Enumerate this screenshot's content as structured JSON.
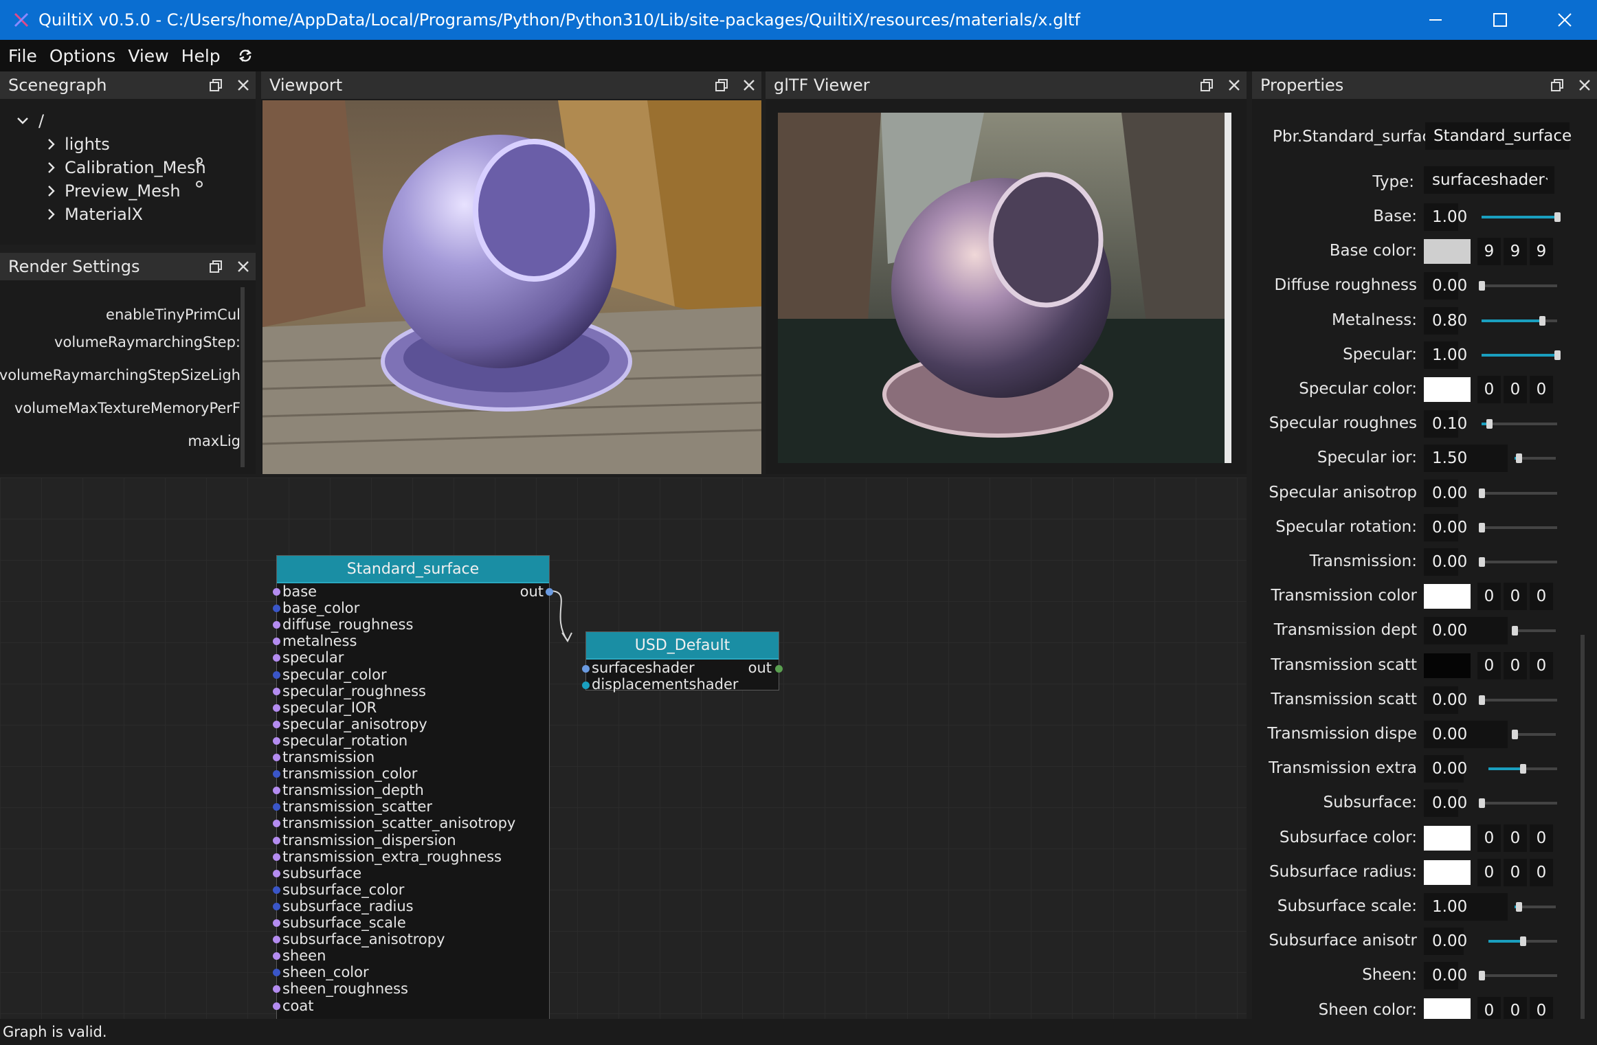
{
  "window": {
    "title": "QuiltiX v0.5.0 - C:/Users/home/AppData/Local/Programs/Python/Python310/Lib/site-packages/QuiltiX/resources/materials/x.gltf"
  },
  "menu": [
    "File",
    "Options",
    "View",
    "Help"
  ],
  "scenegraph": {
    "title": "Scenegraph",
    "root": "/",
    "items": [
      "lights",
      "Calibration_Mesh",
      "Preview_Mesh",
      "MaterialX"
    ]
  },
  "render_settings": {
    "title": "Render Settings",
    "items": [
      "enableTinyPrimCul",
      "volumeRaymarchingStep:",
      "volumeRaymarchingStepSizeLigh",
      "volumeMaxTextureMemoryPerF",
      "maxLig"
    ]
  },
  "viewport": {
    "title": "Viewport"
  },
  "gltf_viewer": {
    "title": "glTF Viewer"
  },
  "properties": {
    "title": "Properties",
    "node_type": "Pbr.Standard_surface",
    "node_name": "Standard_surface",
    "type_label": "Type:",
    "type_value": "surfaceshader",
    "rows": [
      {
        "label": "Base:",
        "kind": "slider",
        "value": "1.00",
        "level": 1.0
      },
      {
        "label": "Base color:",
        "kind": "color",
        "color": "#cfcfcf",
        "rgb": [
          "9",
          "9",
          "9"
        ]
      },
      {
        "label": "Diffuse roughness",
        "kind": "slider",
        "value": "0.00",
        "level": 0.0
      },
      {
        "label": "Metalness:",
        "kind": "slider",
        "value": "0.80",
        "level": 0.8
      },
      {
        "label": "Specular:",
        "kind": "slider",
        "value": "1.00",
        "level": 1.0
      },
      {
        "label": "Specular color:",
        "kind": "color",
        "color": "#ffffff",
        "rgb": [
          "0",
          "0",
          "0"
        ]
      },
      {
        "label": "Specular roughnes",
        "kind": "slider",
        "value": "0.10",
        "level": 0.1
      },
      {
        "label": "Specular ior:",
        "kind": "slider2",
        "value": "1.50",
        "level": 0.1
      },
      {
        "label": "Specular anisotrop",
        "kind": "slider",
        "value": "0.00",
        "level": 0.0
      },
      {
        "label": "Specular rotation:",
        "kind": "slider",
        "value": "0.00",
        "level": 0.0
      },
      {
        "label": "Transmission:",
        "kind": "slider",
        "value": "0.00",
        "level": 0.0
      },
      {
        "label": "Transmission color",
        "kind": "color",
        "color": "#ffffff",
        "rgb": [
          "0",
          "0",
          "0"
        ]
      },
      {
        "label": "Transmission dept",
        "kind": "slider2",
        "value": "0.00",
        "level": 0.0
      },
      {
        "label": "Transmission scatt",
        "kind": "color",
        "color": "#050505",
        "rgb": [
          "0",
          "0",
          "0"
        ]
      },
      {
        "label": "Transmission scatt",
        "kind": "slider",
        "value": "0.00",
        "level": 0.0
      },
      {
        "label": "Transmission dispe",
        "kind": "slider2",
        "value": "0.00",
        "level": 0.0
      },
      {
        "label": "Transmission extra",
        "kind": "slider3",
        "value": "0.00",
        "level": 0.5
      },
      {
        "label": "Subsurface:",
        "kind": "slider",
        "value": "0.00",
        "level": 0.0
      },
      {
        "label": "Subsurface color:",
        "kind": "color",
        "color": "#ffffff",
        "rgb": [
          "0",
          "0",
          "0"
        ]
      },
      {
        "label": "Subsurface radius:",
        "kind": "color",
        "color": "#ffffff",
        "rgb": [
          "0",
          "0",
          "0"
        ]
      },
      {
        "label": "Subsurface scale:",
        "kind": "slider2",
        "value": "1.00",
        "level": 0.1
      },
      {
        "label": "Subsurface anisotr",
        "kind": "slider3",
        "value": "0.00",
        "level": 0.5
      },
      {
        "label": "Sheen:",
        "kind": "slider",
        "value": "0.00",
        "level": 0.0
      },
      {
        "label": "Sheen color:",
        "kind": "color",
        "color": "#ffffff",
        "rgb": [
          "0",
          "0",
          "0"
        ]
      }
    ]
  },
  "graph": {
    "node1": {
      "title": "Standard_surface",
      "out": "out",
      "ports": [
        "base",
        "base_color",
        "diffuse_roughness",
        "metalness",
        "specular",
        "specular_color",
        "specular_roughness",
        "specular_IOR",
        "specular_anisotropy",
        "specular_rotation",
        "transmission",
        "transmission_color",
        "transmission_depth",
        "transmission_scatter",
        "transmission_scatter_anisotropy",
        "transmission_dispersion",
        "transmission_extra_roughness",
        "subsurface",
        "subsurface_color",
        "subsurface_radius",
        "subsurface_scale",
        "subsurface_anisotropy",
        "sheen",
        "sheen_color",
        "sheen_roughness",
        "coat"
      ],
      "port_kinds": [
        "f",
        "c",
        "f",
        "f",
        "f",
        "c",
        "f",
        "f",
        "f",
        "f",
        "f",
        "c",
        "f",
        "c",
        "f",
        "f",
        "f",
        "f",
        "c",
        "c",
        "f",
        "f",
        "f",
        "c",
        "f",
        "f"
      ]
    },
    "node2": {
      "title": "USD_Default",
      "out": "out",
      "ports": [
        "surfaceshader",
        "displacementshader"
      ]
    }
  },
  "colors": {
    "accent": "#0a6ed1",
    "node_header": "#1a8ea4",
    "float_port": "#b48cf0",
    "color_port": "#3a56c8",
    "slider": "#1a9fbf"
  },
  "status": "Graph is valid."
}
